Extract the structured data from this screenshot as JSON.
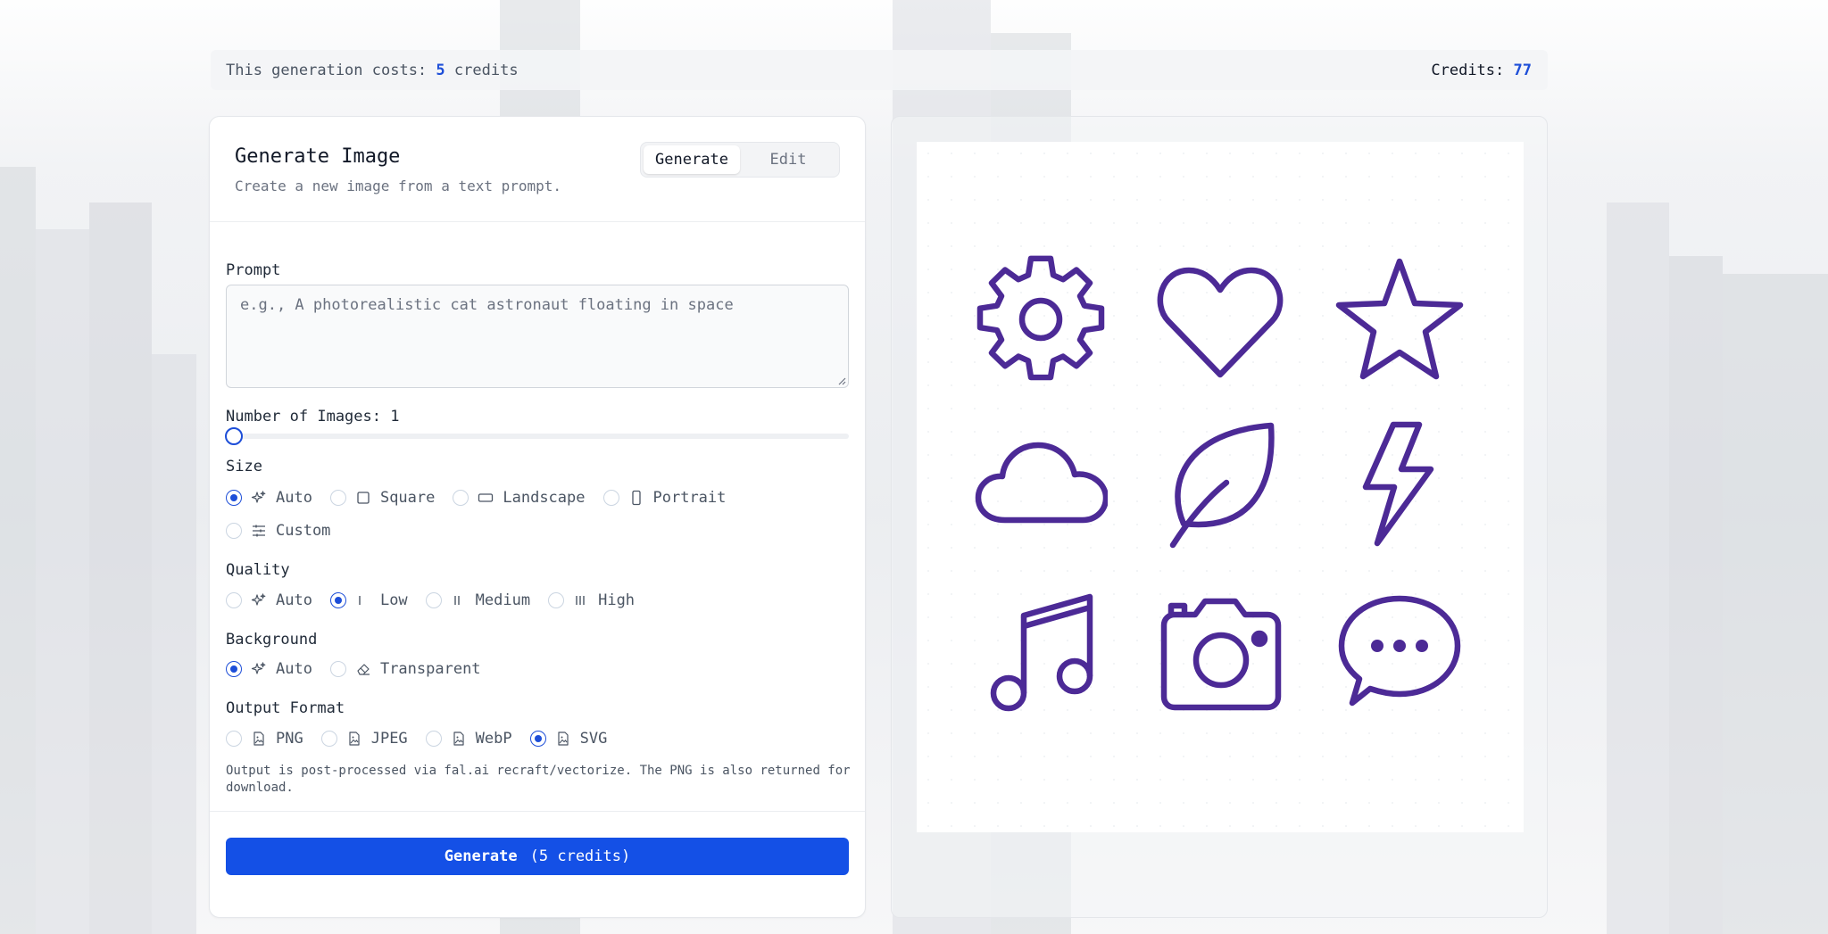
{
  "cost_bar": {
    "cost_prefix": "This generation costs:",
    "cost_value": "5",
    "cost_suffix": "credits",
    "credits_label": "Credits:",
    "credits_value": "77"
  },
  "panel": {
    "title": "Generate Image",
    "subtitle": "Create a new image from a text prompt.",
    "mode_tabs": [
      {
        "label": "Generate",
        "active": true
      },
      {
        "label": "Edit",
        "active": false
      }
    ]
  },
  "prompt": {
    "label": "Prompt",
    "placeholder": "e.g., A photorealistic cat astronaut floating in space",
    "value": ""
  },
  "num_images": {
    "label": "Number of Images: 1",
    "value": 1
  },
  "size": {
    "label": "Size",
    "options": [
      {
        "label": "Auto",
        "icon": "sparkles-icon",
        "selected": true
      },
      {
        "label": "Square",
        "icon": "square-icon",
        "selected": false
      },
      {
        "label": "Landscape",
        "icon": "landscape-icon",
        "selected": false
      },
      {
        "label": "Portrait",
        "icon": "portrait-icon",
        "selected": false
      },
      {
        "label": "Custom",
        "icon": "sliders-icon",
        "selected": false
      }
    ]
  },
  "quality": {
    "label": "Quality",
    "options": [
      {
        "label": "Auto",
        "icon": "sparkles-icon",
        "selected": false
      },
      {
        "label": "Low",
        "icon": "one-bar-icon",
        "selected": true
      },
      {
        "label": "Medium",
        "icon": "two-bars-icon",
        "selected": false
      },
      {
        "label": "High",
        "icon": "three-bars-icon",
        "selected": false
      }
    ]
  },
  "background": {
    "label": "Background",
    "options": [
      {
        "label": "Auto",
        "icon": "sparkles-icon",
        "selected": true
      },
      {
        "label": "Transparent",
        "icon": "eraser-icon",
        "selected": false
      }
    ]
  },
  "output_format": {
    "label": "Output Format",
    "options": [
      {
        "label": "PNG",
        "icon": "image-file-icon",
        "selected": false
      },
      {
        "label": "JPEG",
        "icon": "image-file-icon",
        "selected": false
      },
      {
        "label": "WebP",
        "icon": "image-file-icon",
        "selected": false
      },
      {
        "label": "SVG",
        "icon": "image-file-icon",
        "selected": true
      }
    ],
    "note": "Output is post-processed via fal.ai recraft/vectorize. The PNG is also returned for download."
  },
  "generate_button": {
    "label": "Generate",
    "credits": "(5 credits)"
  },
  "preview": {
    "icons": [
      "gear-icon",
      "heart-icon",
      "star-icon",
      "cloud-icon",
      "leaf-icon",
      "lightning-icon",
      "music-note-icon",
      "camera-icon",
      "chat-bubble-icon"
    ],
    "icon_color": "#4c2a96"
  },
  "colors": {
    "accent": "#1d4ed8",
    "button": "#1450e6",
    "icon_stroke": "#4c2a96"
  }
}
